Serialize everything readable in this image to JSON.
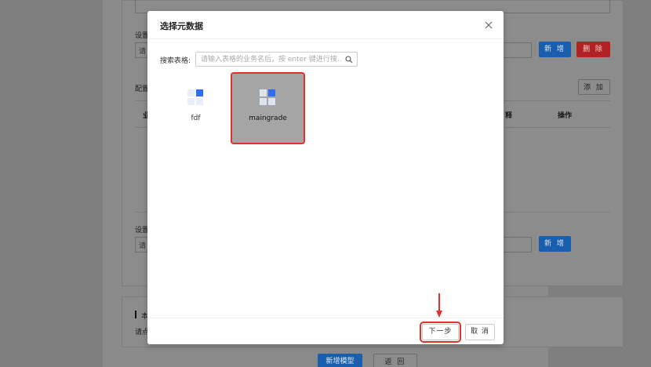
{
  "background": {
    "labels": {
      "setting1": "设置",
      "config": "配置",
      "setting2": "设置",
      "section_prefix": "本",
      "hint_prefix": "请点",
      "biz_col_prefix": "业",
      "col_note_suffix": "释",
      "col_ops": "操作"
    },
    "input_prefix1": "请",
    "input_prefix2": "请",
    "buttons": {
      "add1": "新 增",
      "delete": "删 除",
      "add_row": "添 加",
      "add2": "新 增",
      "new_model": "新增模型",
      "back": "返 回"
    }
  },
  "modal": {
    "title": "选择元数据",
    "search_label": "搜索表格:",
    "search_placeholder": "请输入表格的业务名后，按 enter 键进行搜...",
    "tables": [
      {
        "label": "fdf",
        "selected": false
      },
      {
        "label": "maingrade",
        "selected": true
      }
    ],
    "footer": {
      "next": "下一步",
      "cancel": "取 消"
    }
  },
  "colors": {
    "accent_blue": "#1a5fae",
    "danger_red": "#b22222",
    "highlight_red": "#e0312a",
    "icon_blue": "#2f6ef3",
    "icon_light": "#dbe5fb"
  },
  "icons": [
    "close-icon",
    "search-icon",
    "table-grid-icon",
    "arrow-down-icon"
  ]
}
